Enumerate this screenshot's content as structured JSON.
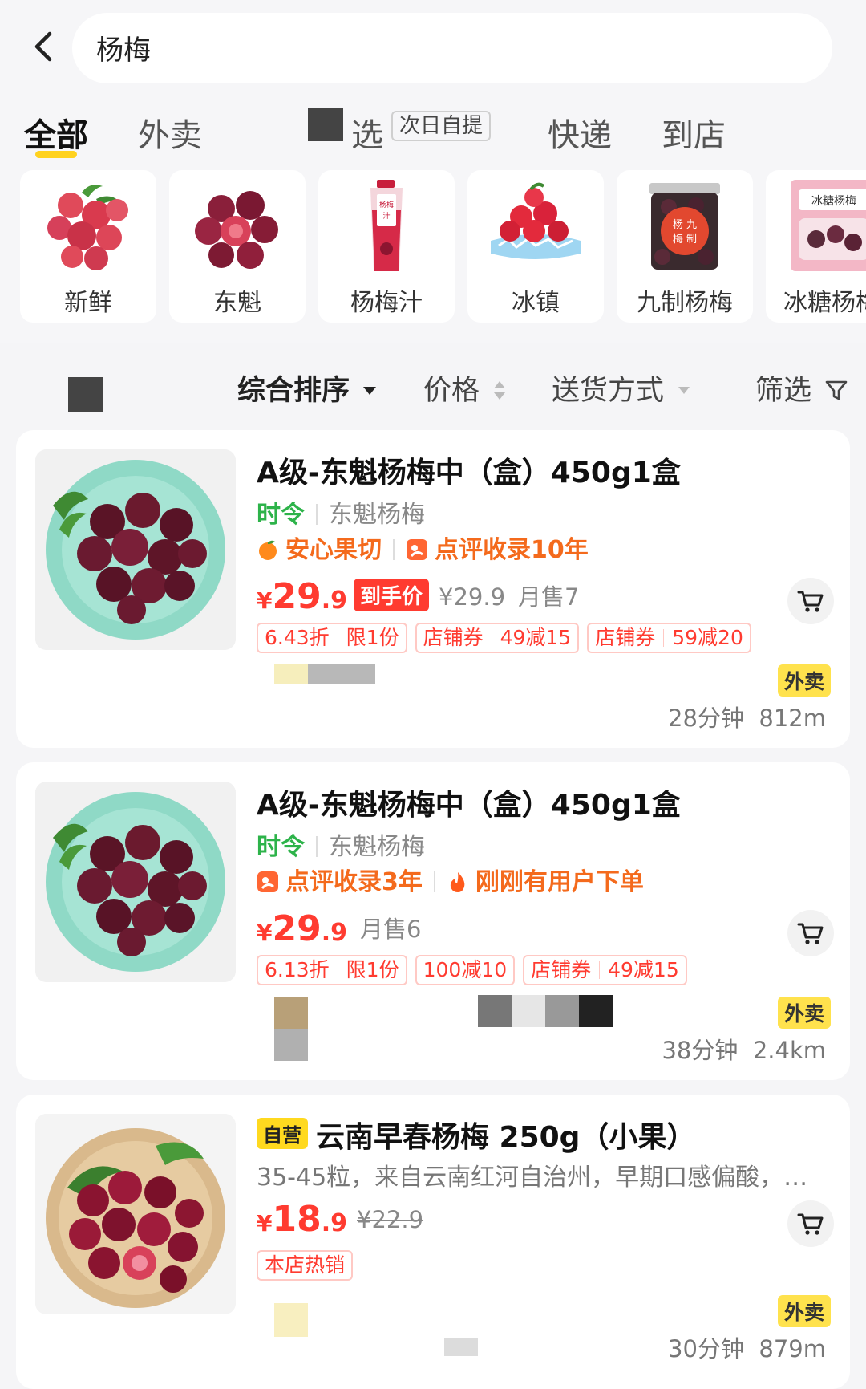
{
  "search": {
    "query": "杨梅"
  },
  "tabs": [
    {
      "label": "全部",
      "active": true
    },
    {
      "label": "外卖"
    },
    {
      "label": "选",
      "pill": "次日自提"
    },
    {
      "label": "快递"
    },
    {
      "label": "到店"
    }
  ],
  "categories": [
    {
      "label": "新鲜",
      "icon": "fresh-bayberry-icon"
    },
    {
      "label": "东魁",
      "icon": "dongkui-bayberry-icon"
    },
    {
      "label": "杨梅汁",
      "icon": "bayberry-juice-icon"
    },
    {
      "label": "冰镇",
      "icon": "iced-bayberry-icon"
    },
    {
      "label": "九制杨梅",
      "icon": "preserved-bayberry-jar-icon"
    },
    {
      "label": "冰糖杨梅",
      "icon": "candied-bayberry-bag-icon"
    }
  ],
  "filters": {
    "sort": "综合排序",
    "price": "价格",
    "delivery": "送货方式",
    "filter": "筛选"
  },
  "products": [
    {
      "title": "A级-东魁杨梅中（盒）450g1盒",
      "season_tag": "时令",
      "variety": "东魁杨梅",
      "tag1": "安心果切",
      "tag2": "点评收录10年",
      "price_yen": "¥",
      "price_int": "29",
      "price_dec": ".9",
      "price_badge": "到手价",
      "orig_price": "¥29.9",
      "monthly_sales": "月售7",
      "coupons": [
        {
          "a": "6.43折",
          "b": "限1份"
        },
        {
          "a": "店铺券",
          "b": "49减15"
        },
        {
          "a": "店铺券",
          "b": "59减20"
        }
      ],
      "delivery_badge": "外卖",
      "eta": "28分钟",
      "distance": "812m"
    },
    {
      "title": "A级-东魁杨梅中（盒）450g1盒",
      "season_tag": "时令",
      "variety": "东魁杨梅",
      "tag1": "点评收录3年",
      "tag2": "刚刚有用户下单",
      "price_yen": "¥",
      "price_int": "29",
      "price_dec": ".9",
      "monthly_sales": "月售6",
      "coupons": [
        {
          "a": "6.13折",
          "b": "限1份"
        },
        {
          "a": "100减10"
        },
        {
          "a": "店铺券",
          "b": "49减15"
        }
      ],
      "delivery_badge": "外卖",
      "eta": "38分钟",
      "distance": "2.4km"
    },
    {
      "self_badge": "自营",
      "title": "云南早春杨梅  250g（小果）",
      "description": "35-45粒，来自云南红河自治州，早期口感偏酸，…",
      "price_yen": "¥",
      "price_int": "18",
      "price_dec": ".9",
      "orig_price": "¥22.9",
      "hot_tag": "本店热销",
      "delivery_badge": "外卖",
      "eta": "30分钟",
      "distance": "879m"
    }
  ]
}
